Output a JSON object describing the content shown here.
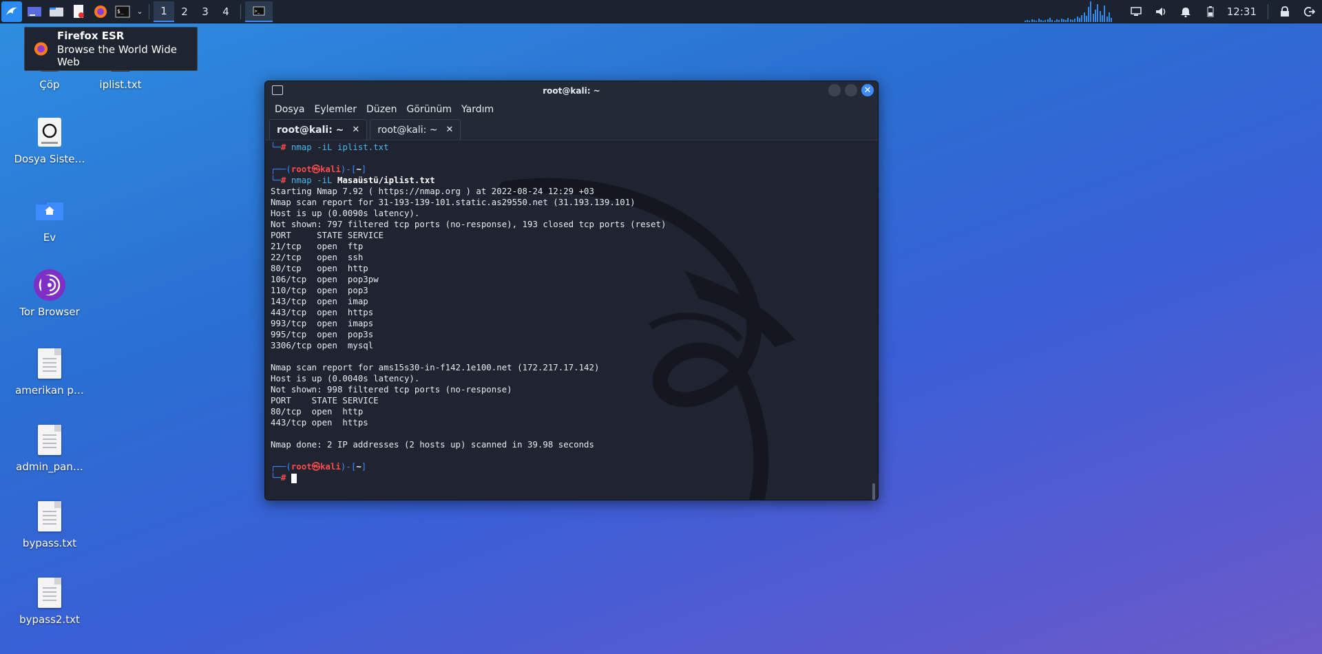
{
  "taskbar": {
    "workspaces": [
      "1",
      "2",
      "3",
      "4"
    ],
    "active_workspace": "1",
    "clock": "12:31"
  },
  "tooltip": {
    "title": "Firefox ESR",
    "description": "Browse the World Wide Web"
  },
  "desktop": {
    "icons": [
      {
        "label": "Çöp",
        "icon": "trash-icon"
      },
      {
        "label": "iplist.txt",
        "icon": "text-file-icon"
      },
      {
        "label": "Dosya Siste…",
        "icon": "drive-icon"
      },
      {
        "label": "Ev",
        "icon": "home-folder-icon"
      },
      {
        "label": "Tor Browser",
        "icon": "tor-browser-icon"
      },
      {
        "label": "amerikan p…",
        "icon": "text-file-icon"
      },
      {
        "label": "admin_pan…",
        "icon": "text-file-icon"
      },
      {
        "label": "bypass.txt",
        "icon": "text-file-icon"
      },
      {
        "label": "bypass2.txt",
        "icon": "text-file-icon"
      }
    ]
  },
  "terminal": {
    "title": "root@kali: ~",
    "menu": [
      "Dosya",
      "Eylemler",
      "Düzen",
      "Görünüm",
      "Yardım"
    ],
    "tabs": [
      {
        "label": "root@kali: ~",
        "active": true
      },
      {
        "label": "root@kali: ~",
        "active": false
      }
    ],
    "prompt": {
      "user": "root",
      "at": "㉿",
      "host": "kali",
      "dir": "~"
    },
    "first_cmd": "nmap -iL iplist.txt",
    "second_cmd_prefix": "nmap -iL ",
    "second_cmd_arg": "Masaüstü/iplist.txt",
    "output": [
      "Starting Nmap 7.92 ( https://nmap.org ) at 2022-08-24 12:29 +03",
      "Nmap scan report for 31-193-139-101.static.as29550.net (31.193.139.101)",
      "Host is up (0.0090s latency).",
      "Not shown: 797 filtered tcp ports (no-response), 193 closed tcp ports (reset)",
      "PORT     STATE SERVICE",
      "21/tcp   open  ftp",
      "22/tcp   open  ssh",
      "80/tcp   open  http",
      "106/tcp  open  pop3pw",
      "110/tcp  open  pop3",
      "143/tcp  open  imap",
      "443/tcp  open  https",
      "993/tcp  open  imaps",
      "995/tcp  open  pop3s",
      "3306/tcp open  mysql",
      "",
      "Nmap scan report for ams15s30-in-f142.1e100.net (172.217.17.142)",
      "Host is up (0.0040s latency).",
      "Not shown: 998 filtered tcp ports (no-response)",
      "PORT    STATE SERVICE",
      "80/tcp  open  http",
      "443/tcp open  https",
      "",
      "Nmap done: 2 IP addresses (2 hosts up) scanned in 39.98 seconds"
    ]
  }
}
